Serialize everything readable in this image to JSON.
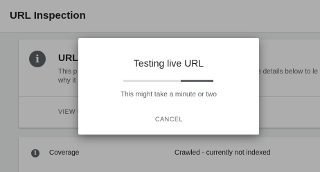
{
  "header": {
    "title": "URL Inspection"
  },
  "card": {
    "title": "URL",
    "desc_line1": "This p",
    "desc_line1_right": "e details below to le",
    "desc_line2": "why it",
    "view_link": "VIEW C"
  },
  "coverage": {
    "label": "Coverage",
    "value": "Crawled - currently not indexed"
  },
  "dialog": {
    "title": "Testing live URL",
    "subtitle": "This might take a minute or two",
    "cancel_label": "CANCEL",
    "progress": {
      "indeterminate": true,
      "highlight_start": 0.64,
      "highlight_end": 1.0
    }
  },
  "icons": {
    "info": "info-icon"
  },
  "colors": {
    "scrim": "rgba(0,0,0,0.32)",
    "icon": "#5f6368",
    "progress_track": "#e0e0e0",
    "progress_fill": "#5f6368"
  }
}
